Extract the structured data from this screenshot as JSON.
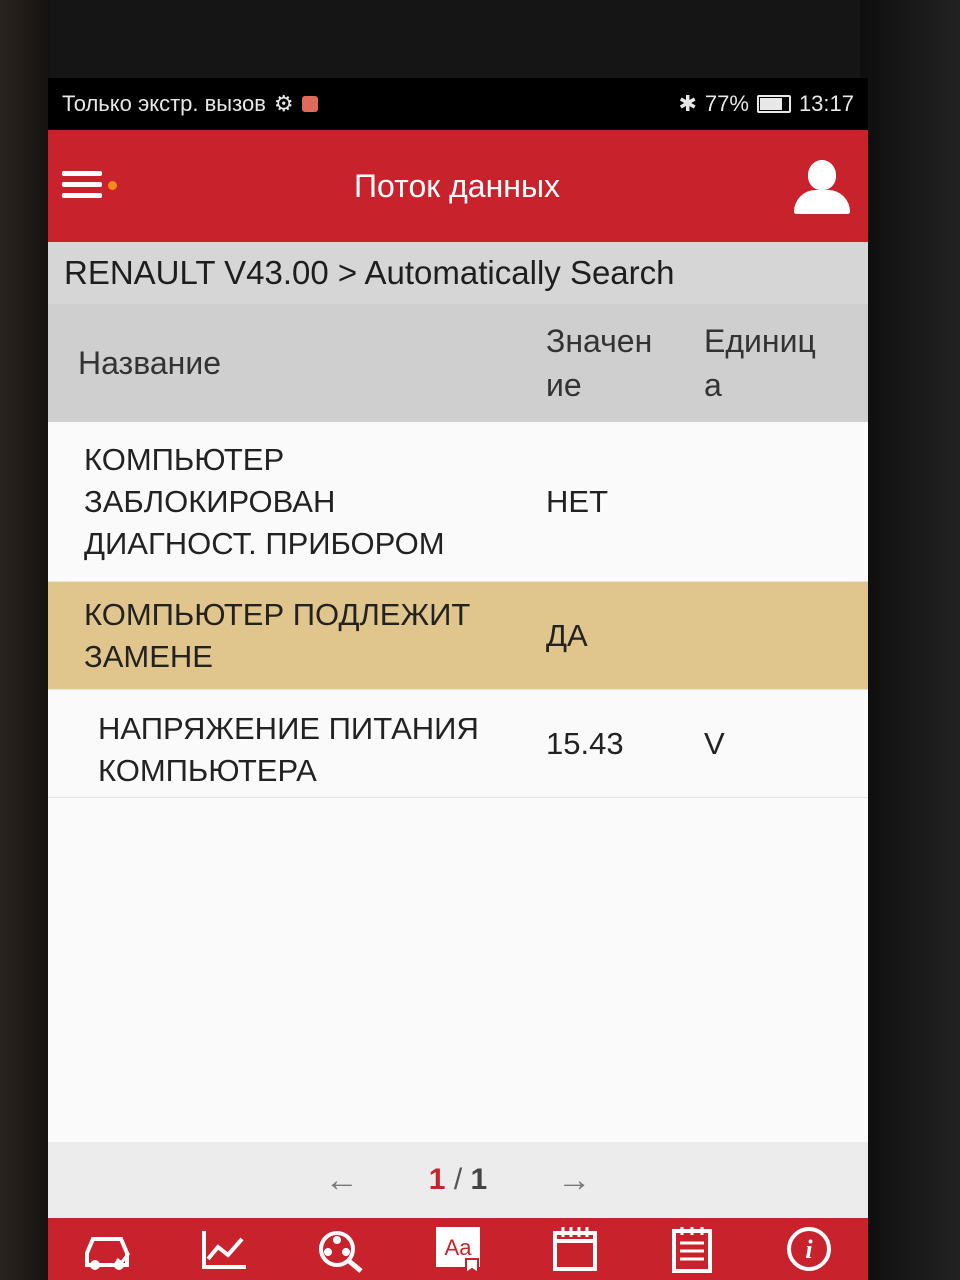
{
  "status_bar": {
    "carrier_text": "Только экстр. вызов",
    "battery_percent": "77%",
    "time": "13:17"
  },
  "app_bar": {
    "title": "Поток данных",
    "menu_icon": "hamburger-menu-icon",
    "user_icon": "user-profile-icon"
  },
  "breadcrumb": "RENAULT V43.00 > Automatically Search",
  "table": {
    "headers": {
      "name": "Название",
      "value_line1": "Значен",
      "value_line2": "ие",
      "unit_line1": "Единиц",
      "unit_line2": "а"
    },
    "rows": [
      {
        "name_lines": [
          "КОМПЬЮТЕР",
          "ЗАБЛОКИРОВАН",
          "ДИАГНОСТ. ПРИБОРОМ"
        ],
        "value": "НЕТ",
        "unit": ""
      },
      {
        "name_lines": [
          "КОМПЬЮТЕР ПОДЛЕЖИТ",
          "ЗАМЕНЕ"
        ],
        "value": "ДА",
        "unit": "",
        "highlighted": true
      },
      {
        "name_lines": [
          "НАПРЯЖЕНИЕ ПИТАНИЯ",
          "КОМПЬЮТЕРА"
        ],
        "value": "15.43",
        "unit": "V"
      }
    ]
  },
  "pager": {
    "prev": "←",
    "current": "1",
    "separator": " / ",
    "total": "1",
    "next": "→"
  },
  "colors": {
    "accent_red": "#c8232c",
    "highlight_row": "#e0c68c"
  },
  "toolbar_icons": [
    "car-icon",
    "graph-icon",
    "film-reel-search-icon",
    "font-size-icon",
    "calendar-icon",
    "report-icon",
    "info-icon"
  ]
}
